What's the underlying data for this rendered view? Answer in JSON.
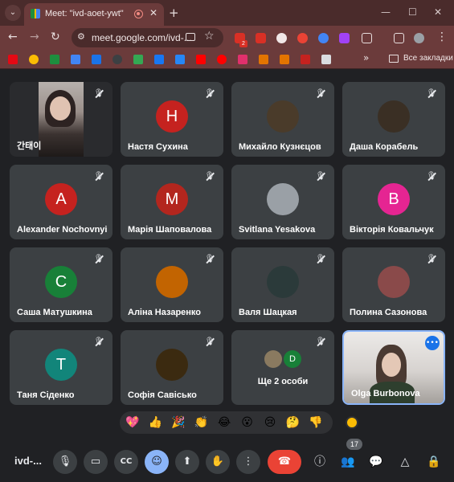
{
  "browser": {
    "tab_title": "Meet: \"ivd-aoet-ywt\"",
    "tab_menu_icon": "chevron-down-icon",
    "url": "meet.google.com/ivd-...",
    "window_controls": [
      "minimize-icon",
      "maximize-icon",
      "close-icon"
    ],
    "nav": [
      "back-icon",
      "forward-icon",
      "reload-icon"
    ],
    "extension_badge": "2",
    "bookmarks_folder_label": "Все закладки"
  },
  "participants": [
    {
      "name": "간태이",
      "type": "video"
    },
    {
      "name": "Настя Сухина",
      "initial": "Н",
      "color": "#c5221f"
    },
    {
      "name": "Михайло Кузнєцов",
      "type": "photo",
      "color": "#4a3b2a"
    },
    {
      "name": "Даша Корабель",
      "type": "photo",
      "color": "#3a2f24"
    },
    {
      "name": "Alexander Nochovnyi",
      "initial": "A",
      "color": "#c5221f"
    },
    {
      "name": "Марія Шаповалова",
      "initial": "М",
      "color": "#b3261e"
    },
    {
      "name": "Svitlana Yesakova",
      "type": "photo",
      "color": "#9aa0a6"
    },
    {
      "name": "Вікторія Ковальчук",
      "initial": "В",
      "color": "#e52592"
    },
    {
      "name": "Саша Матушкина",
      "initial": "С",
      "color": "#188038"
    },
    {
      "name": "Аліна Назаренко",
      "type": "photo",
      "color": "#c26401"
    },
    {
      "name": "Валя Шацкая",
      "type": "photo",
      "color": "#2b3a3a"
    },
    {
      "name": "Полина Сазонова",
      "type": "photo",
      "color": "#8a4a4a"
    },
    {
      "name": "Таня Сіденко",
      "initial": "T",
      "color": "#12857a"
    },
    {
      "name": "Софія Савісько",
      "type": "photo",
      "color": "#3b2a10"
    },
    {
      "name": "Ще 2 особи",
      "type": "more",
      "initial": "D",
      "color": "#188038"
    },
    {
      "name": "Olga Burbonova",
      "type": "self"
    }
  ],
  "reactions": [
    "💖",
    "👍",
    "🎉",
    "👏",
    "😂",
    "😮",
    "😢",
    "🤔",
    "👎"
  ],
  "controls": {
    "meeting_code": "ivd-...",
    "participant_count": "17"
  },
  "colors": {
    "browser_frame": "#6b3b3b",
    "meet_background": "#202124",
    "tile": "#3c4043",
    "hangup": "#ea4335",
    "active_control": "#8ab4f8"
  }
}
